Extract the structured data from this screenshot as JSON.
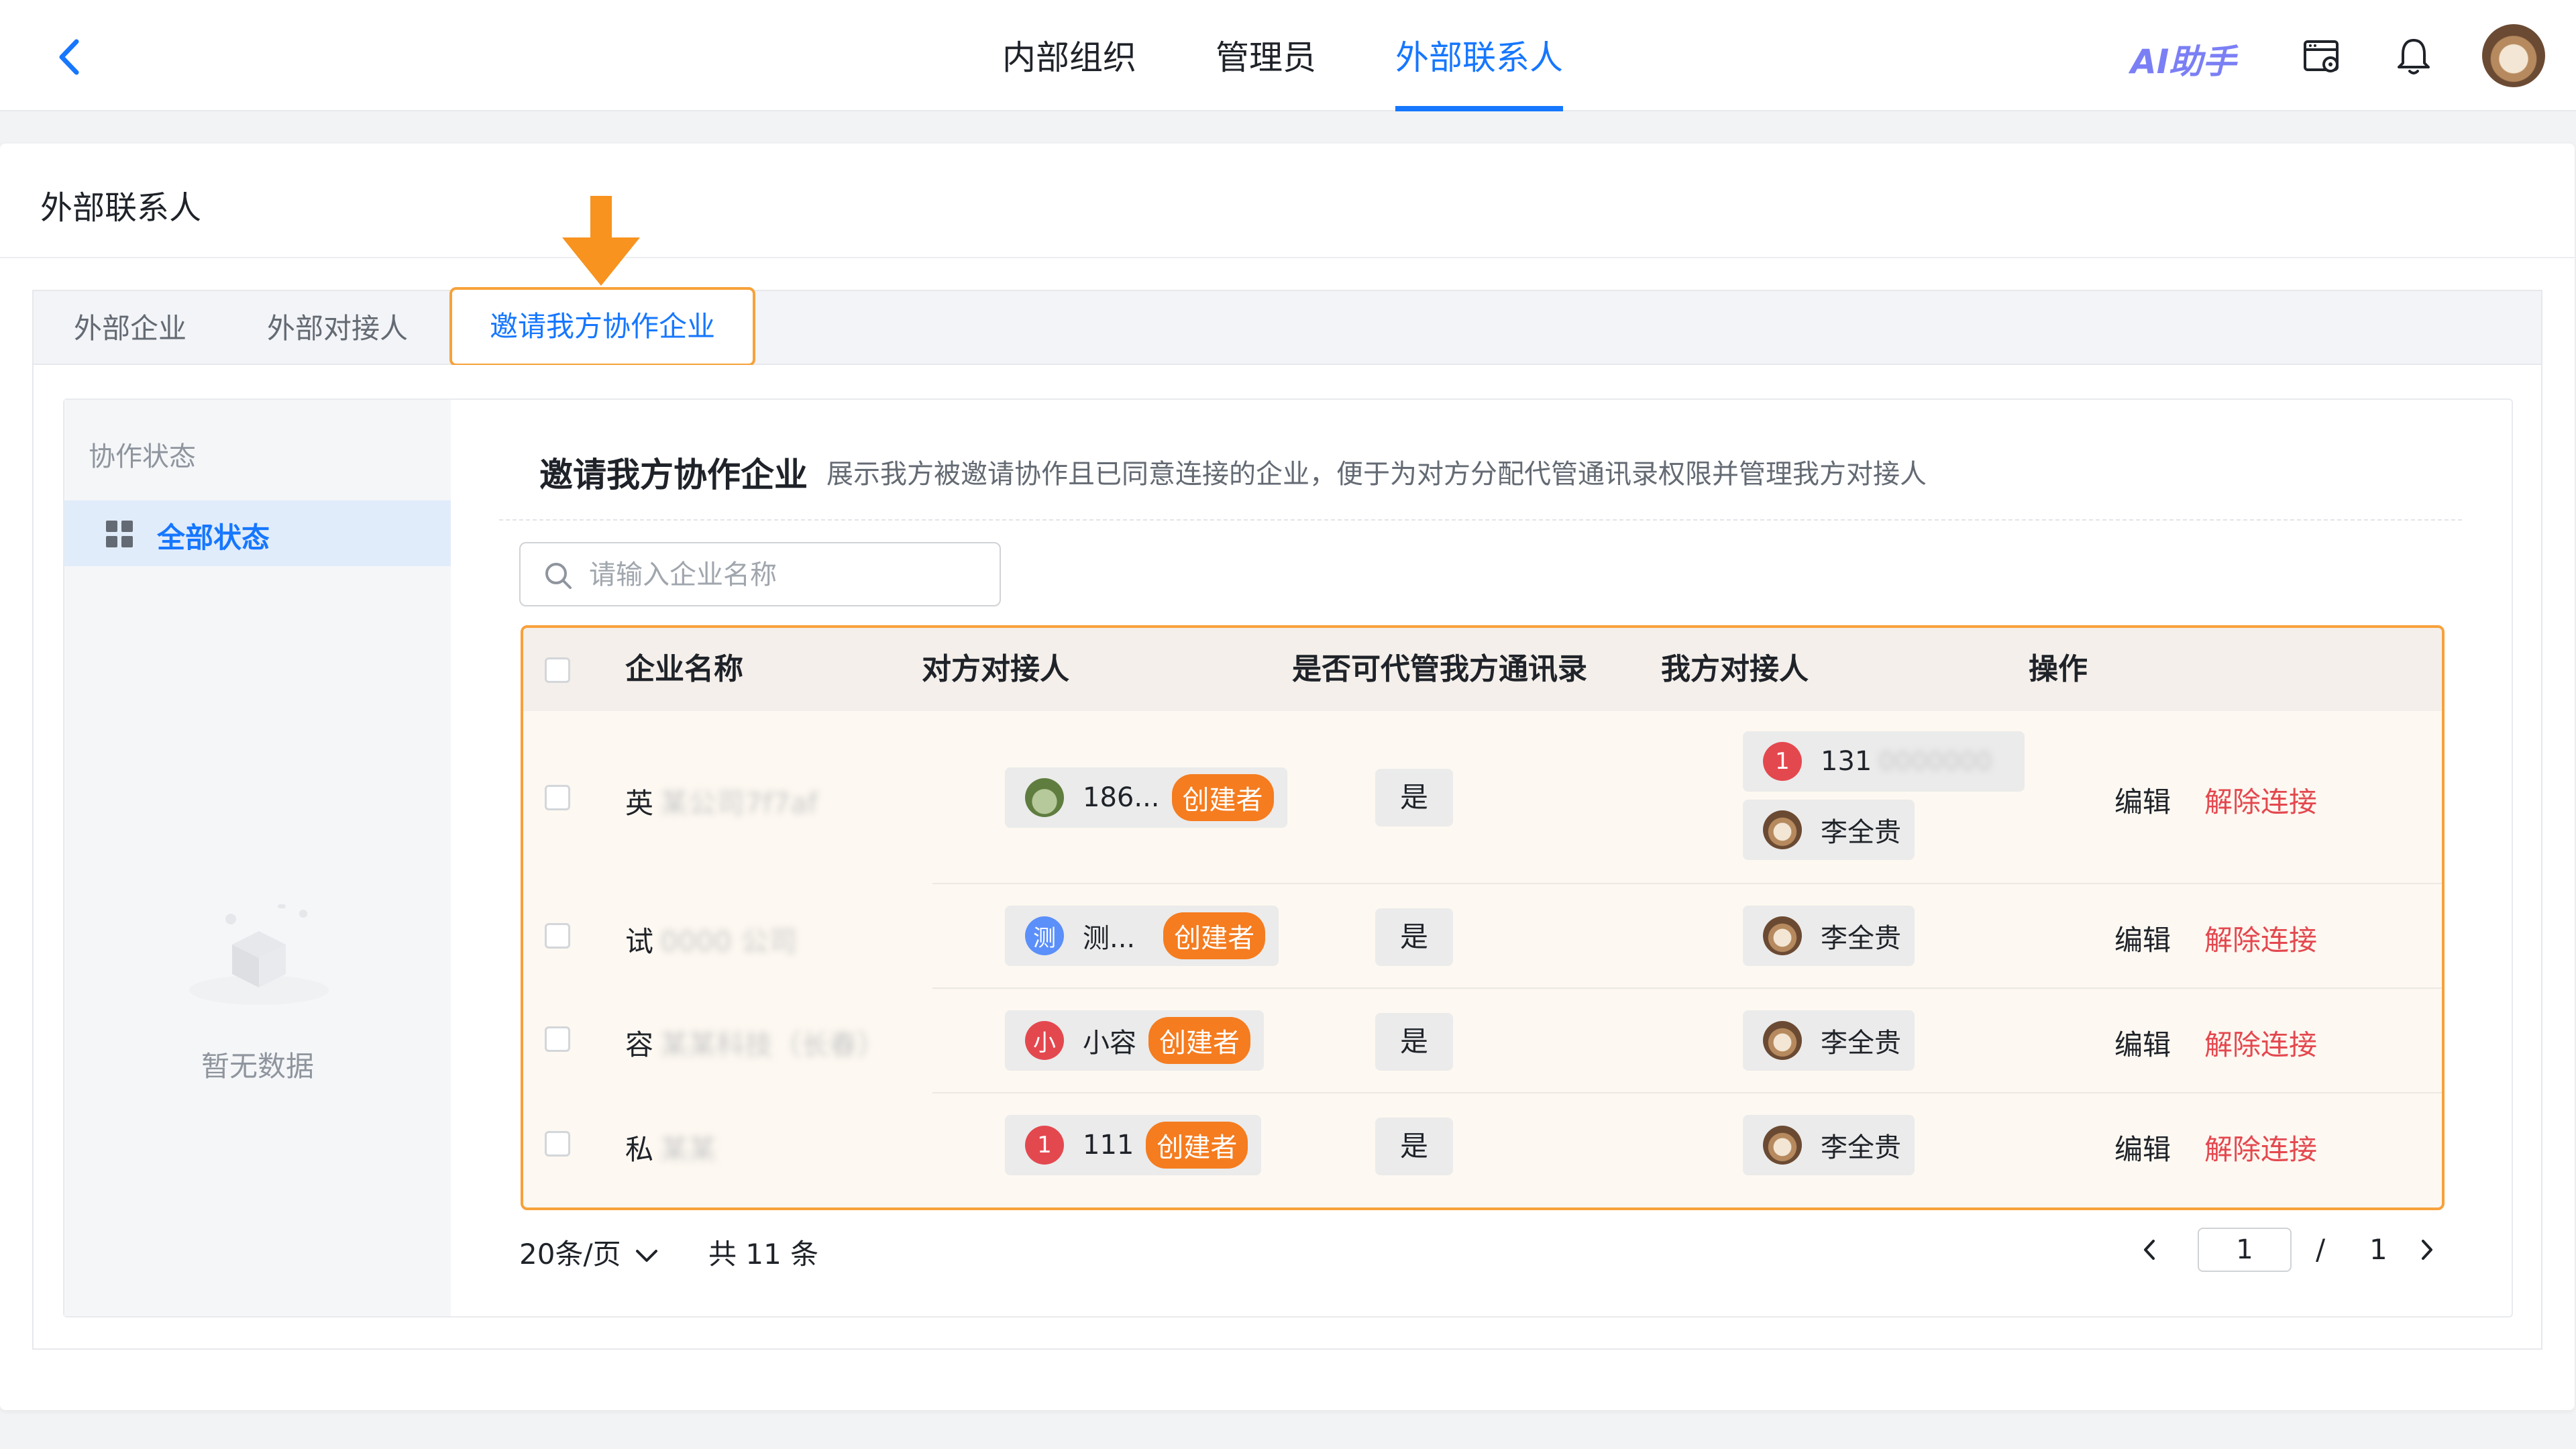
{
  "topbar": {
    "nav": [
      {
        "label": "内部组织",
        "active": false
      },
      {
        "label": "管理员",
        "active": false
      },
      {
        "label": "外部联系人",
        "active": true
      }
    ],
    "ai_button": "AI助手",
    "icons": [
      "back-arrow-icon",
      "admin-console-icon",
      "bell-icon",
      "avatar"
    ],
    "accent_color": "#1677ff"
  },
  "page": {
    "title": "外部联系人",
    "tabs": [
      {
        "label": "外部企业",
        "active": false
      },
      {
        "label": "外部对接人",
        "active": false
      },
      {
        "label": "邀请我方协作企业",
        "active": true
      }
    ],
    "highlight_color": "#f7a13a"
  },
  "sidebar": {
    "group_label": "协作状态",
    "items": [
      {
        "label": "全部状态",
        "active": true,
        "icon": "grid-icon"
      }
    ],
    "empty_text": "暂无数据"
  },
  "section": {
    "title": "邀请我方协作企业",
    "description": "展示我方被邀请协作且已同意连接的企业，便于为对方分配代管通讯录权限并管理我方对接人"
  },
  "search": {
    "placeholder": "请输入企业名称",
    "value": ""
  },
  "table": {
    "columns": [
      "企业名称",
      "对方对接人",
      "是否可代管我方通讯录",
      "我方对接人",
      "操作"
    ],
    "rows": [
      {
        "company": "英",
        "company_hidden": "某公司7f7af",
        "their_contact": {
          "avatar_text": "",
          "avatar_style": "photo",
          "name": "186...",
          "tag": "创建者"
        },
        "can_manage": "是",
        "our_contacts": [
          {
            "avatar_text": "1",
            "avatar_style": "red",
            "name": "131",
            "hidden_suffix": "0000000"
          },
          {
            "avatar_text": "",
            "avatar_style": "cup",
            "name": "李全贵"
          }
        ],
        "actions": {
          "edit": "编辑",
          "unlink": "解除连接"
        }
      },
      {
        "company": "试",
        "company_hidden": "0000 公司",
        "their_contact": {
          "avatar_text": "测",
          "avatar_style": "blue",
          "name": "测...",
          "tag": "创建者"
        },
        "can_manage": "是",
        "our_contacts": [
          {
            "avatar_text": "",
            "avatar_style": "cup",
            "name": "李全贵"
          }
        ],
        "actions": {
          "edit": "编辑",
          "unlink": "解除连接"
        }
      },
      {
        "company": "容",
        "company_hidden": "某某科技（长春）",
        "their_contact": {
          "avatar_text": "小",
          "avatar_style": "red",
          "name": "小容",
          "tag": "创建者"
        },
        "can_manage": "是",
        "our_contacts": [
          {
            "avatar_text": "",
            "avatar_style": "cup",
            "name": "李全贵"
          }
        ],
        "actions": {
          "edit": "编辑",
          "unlink": "解除连接"
        }
      },
      {
        "company": "私",
        "company_hidden": "某某",
        "their_contact": {
          "avatar_text": "1",
          "avatar_style": "red",
          "name": "111",
          "tag": "创建者"
        },
        "can_manage": "是",
        "our_contacts": [
          {
            "avatar_text": "",
            "avatar_style": "cup",
            "name": "李全贵"
          }
        ],
        "actions": {
          "edit": "编辑",
          "unlink": "解除连接"
        }
      }
    ]
  },
  "pagination": {
    "page_size": "20条/页",
    "total": "共 11 条",
    "current": "1",
    "separator": "/",
    "pages": "1"
  }
}
